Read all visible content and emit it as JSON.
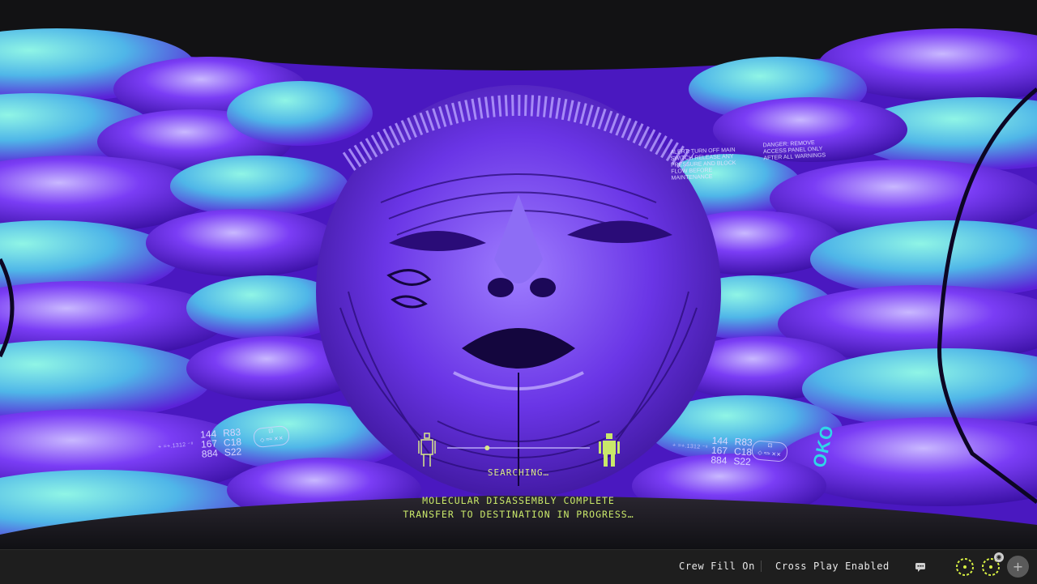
{
  "hud": {
    "status": "SEARCHING…",
    "message_line1": "MOLECULAR DISASSEMBLY COMPLETE",
    "message_line2": "TRANSFER TO DESTINATION IN PROGRESS…",
    "left_readout": {
      "row1": [
        "144",
        "R83"
      ],
      "row2": [
        "167",
        "C18"
      ],
      "row3": [
        "884",
        "S22"
      ]
    },
    "right_readout": {
      "row1": [
        "144",
        "R83"
      ],
      "row2": [
        "167",
        "C18"
      ],
      "row3": [
        "884",
        "S22"
      ]
    },
    "transfer_progress": 0.28,
    "accent_color": "#c9e86a"
  },
  "scene": {
    "logo_text": "OKO",
    "wall_notice_1": "ALERT: TURN OFF MAIN SWITCH RELEASE ANY PRESSURE AND BLOCK FLOW BEFORE MAINTENANCE",
    "wall_notice_2": "DANGER: REMOVE ACCESS PANEL ONLY AFTER ALL WARNINGS",
    "palette": {
      "purple": "#6a2cf0",
      "cyan": "#4fe3d0",
      "light": "#c9b8ff"
    }
  },
  "bottom_bar": {
    "crew_fill": "Crew Fill On",
    "cross_play": "Cross Play Enabled",
    "icons": [
      "chat-icon",
      "ready-icon",
      "ready-icon",
      "add-icon"
    ]
  }
}
